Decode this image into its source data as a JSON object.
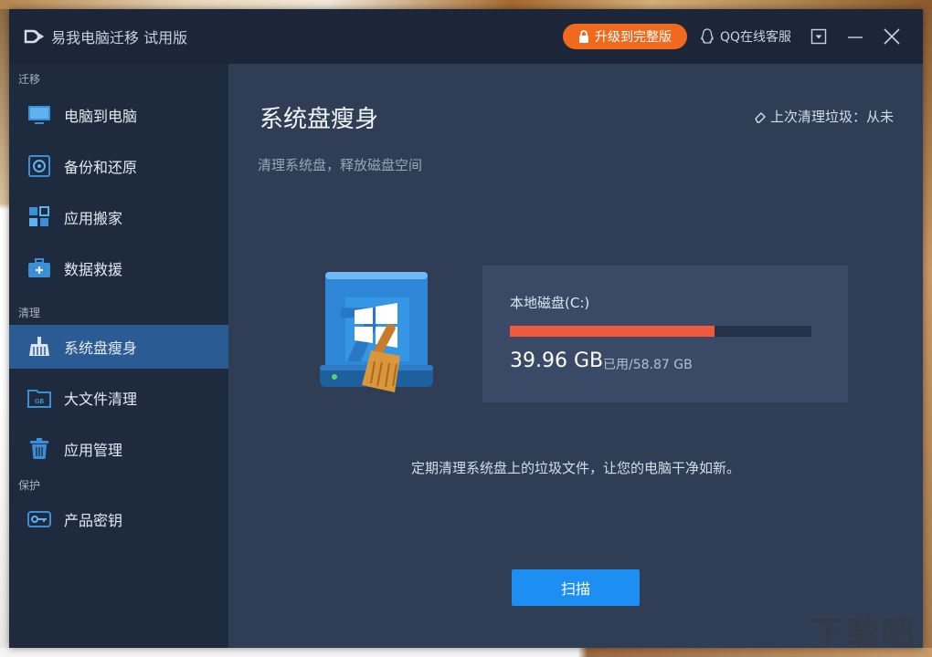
{
  "window": {
    "title": "易我电脑迁移 试用版",
    "upgrade_label": "升级到完整版",
    "support_label": "QQ在线客服"
  },
  "sidebar": {
    "sections": [
      {
        "label": "迁移",
        "items": [
          {
            "label": "电脑到电脑",
            "icon": "monitor-icon"
          },
          {
            "label": "备份和还原",
            "icon": "backup-icon"
          },
          {
            "label": "应用搬家",
            "icon": "apps-icon"
          },
          {
            "label": "数据救援",
            "icon": "rescue-kit-icon"
          }
        ]
      },
      {
        "label": "清理",
        "items": [
          {
            "label": "系统盘瘦身",
            "icon": "broom-icon",
            "active": true
          },
          {
            "label": "大文件清理",
            "icon": "folder-gb-icon"
          },
          {
            "label": "应用管理",
            "icon": "trash-icon"
          }
        ]
      },
      {
        "label": "保护",
        "items": [
          {
            "label": "产品密钥",
            "icon": "key-icon"
          }
        ]
      }
    ]
  },
  "main": {
    "title": "系统盘瘦身",
    "subtitle": "清理系统盘，释放磁盘空间",
    "last_clean": "上次清理垃圾：从未",
    "disk": {
      "name": "本地磁盘(C:)",
      "used": "39.96 GB",
      "used_suffix": "已用/58.87 GB",
      "used_fraction": 0.679
    },
    "tip": "定期清理系统盘上的垃圾文件，让您的电脑干净如新。",
    "scan_label": "扫描"
  },
  "watermark": "下载吧",
  "colors": {
    "accent": "#1d8ff2",
    "upgrade": "#f06a1d",
    "progress": "#f05a3c",
    "sidebar_active": "#2a5c93"
  }
}
